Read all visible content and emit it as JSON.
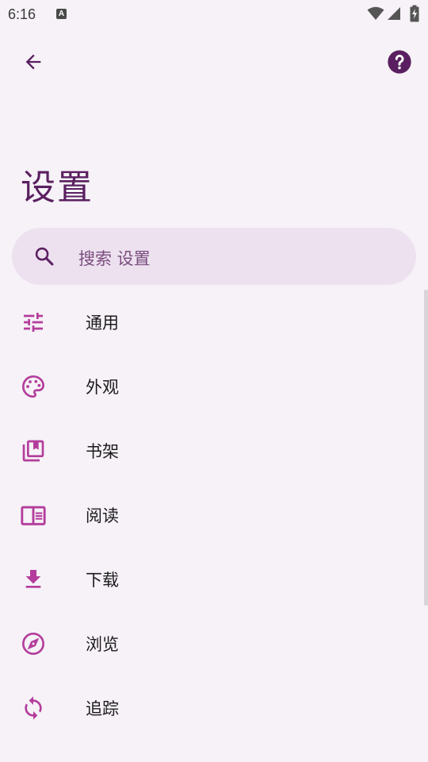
{
  "status_bar": {
    "time": "6:16",
    "notification_glyph": "A"
  },
  "toolbar": {
    "back_icon": "arrow-back-icon",
    "help_icon": "help-circle-icon"
  },
  "page": {
    "title": "设置"
  },
  "search": {
    "placeholder": "搜索 设置"
  },
  "colors": {
    "accent": "#b43d9c",
    "title": "#5a1f60",
    "search_bg": "#ede1f0",
    "background": "#f6f2f7"
  },
  "menu": {
    "items": [
      {
        "label": "通用",
        "icon": "tune-icon"
      },
      {
        "label": "外观",
        "icon": "palette-icon"
      },
      {
        "label": "书架",
        "icon": "library-icon"
      },
      {
        "label": "阅读",
        "icon": "reader-icon"
      },
      {
        "label": "下载",
        "icon": "download-icon"
      },
      {
        "label": "浏览",
        "icon": "explore-icon"
      },
      {
        "label": "追踪",
        "icon": "sync-icon"
      }
    ]
  }
}
